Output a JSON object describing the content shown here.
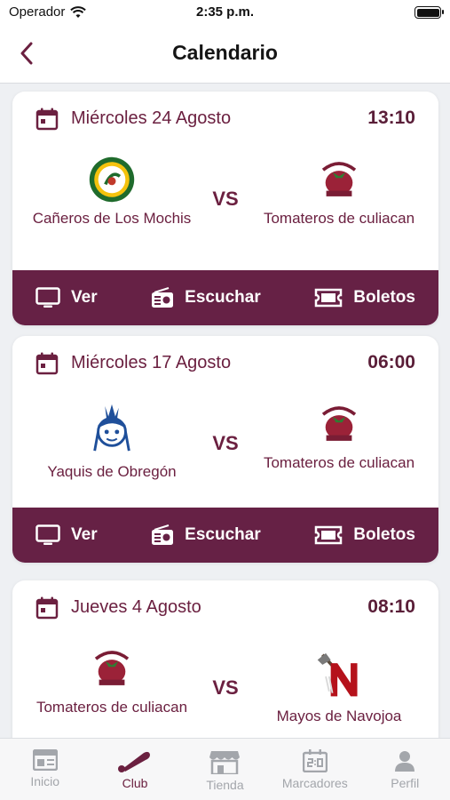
{
  "status": {
    "carrier": "Operador",
    "time": "2:35 p.m."
  },
  "header": {
    "title": "Calendario",
    "back_icon": "chevron-left-icon"
  },
  "colors": {
    "primary": "#662145",
    "accent_text": "#6b2040",
    "inactive": "#a3a6ab"
  },
  "vs_label": "VS",
  "actions": {
    "watch": "Ver",
    "listen": "Escuchar",
    "tickets": "Boletos"
  },
  "games": [
    {
      "date": "Miércoles 24 Agosto",
      "time": "13:10",
      "home": {
        "name": "Cañeros de Los Mochis",
        "logo": "caneros-logo"
      },
      "away": {
        "name": "Tomateros de culiacan",
        "logo": "tomateros-logo"
      }
    },
    {
      "date": "Miércoles 17 Agosto",
      "time": "06:00",
      "home": {
        "name": "Yaquis de Obregón",
        "logo": "yaquis-logo"
      },
      "away": {
        "name": "Tomateros de culiacan",
        "logo": "tomateros-logo"
      }
    },
    {
      "date": "Jueves 4 Agosto",
      "time": "08:10",
      "home": {
        "name": "Tomateros de culiacan",
        "logo": "tomateros-logo"
      },
      "away": {
        "name": "Mayos de Navojoa",
        "logo": "mayos-logo"
      }
    }
  ],
  "tabs": [
    {
      "label": "Inicio",
      "icon": "news-icon",
      "active": false
    },
    {
      "label": "Club",
      "icon": "baseball-bat-icon",
      "active": true
    },
    {
      "label": "Tienda",
      "icon": "store-icon",
      "active": false
    },
    {
      "label": "Marcadores",
      "icon": "scoreboard-icon",
      "active": false
    },
    {
      "label": "Perfil",
      "icon": "person-icon",
      "active": false
    }
  ]
}
